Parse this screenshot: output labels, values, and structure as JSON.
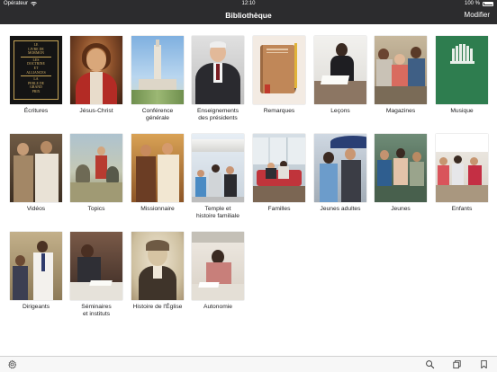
{
  "status": {
    "carrier": "Opérateur",
    "time": "12:10",
    "battery": "100 %"
  },
  "nav": {
    "title": "Bibliothèque",
    "action": "Modifier"
  },
  "colors": {
    "bar": "#2c2c2e",
    "toolbar": "#f7f7f7",
    "musique_green": "#2e7d4f"
  },
  "tiles": [
    {
      "label": "Écritures"
    },
    {
      "label": "Jésus-Christ"
    },
    {
      "label": "Conférence\ngénérale"
    },
    {
      "label": "Enseignements\ndes présidents"
    },
    {
      "label": "Remarques"
    },
    {
      "label": "Leçons"
    },
    {
      "label": "Magazines"
    },
    {
      "label": "Musique"
    },
    {
      "label": "Vidéos"
    },
    {
      "label": "Topics"
    },
    {
      "label": "Missionnaire"
    },
    {
      "label": "Temple et\nhistoire familiale"
    },
    {
      "label": "Familles"
    },
    {
      "label": "Jeunes adultes"
    },
    {
      "label": "Jeunes"
    },
    {
      "label": "Enfants"
    },
    {
      "label": "Dirigeants"
    },
    {
      "label": "Séminaires\net instituts"
    },
    {
      "label": "Histoire de l'Église"
    },
    {
      "label": "Autonomie"
    }
  ],
  "scripture_cover": [
    "LE",
    "LIVRE DE",
    "MORMON",
    "LES",
    "DOCTRINE",
    "ET",
    "ALLIANCES",
    "LA",
    "PERLE DE",
    "GRAND",
    "PRIX"
  ],
  "toolbar": {
    "icons": [
      "gear-icon",
      "search-icon",
      "tabs-icon",
      "bookmark-icon"
    ]
  }
}
